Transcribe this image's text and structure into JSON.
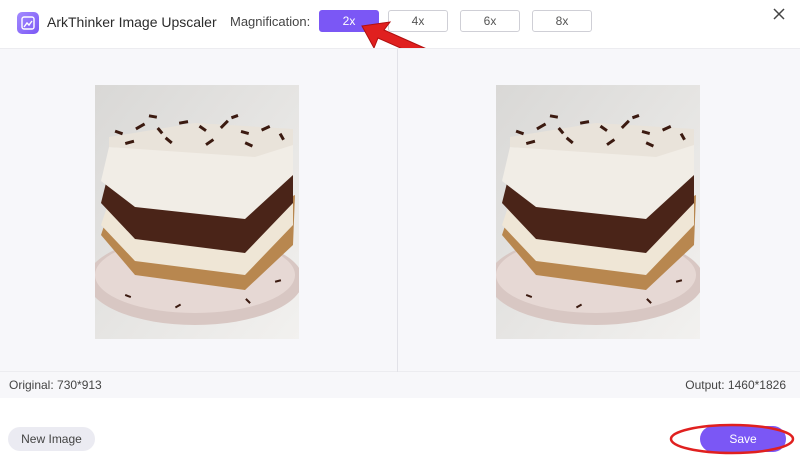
{
  "app": {
    "title": "ArkThinker Image Upscaler",
    "logo_icon": "image-upscale-icon"
  },
  "magnification": {
    "label": "Magnification:",
    "options": [
      "2x",
      "4x",
      "6x",
      "8x"
    ],
    "selected": "2x"
  },
  "preview": {
    "original_label": "Original: 730*913",
    "output_label": "Output: 1460*1826"
  },
  "footer": {
    "new_image_label": "New Image",
    "save_label": "Save"
  },
  "colors": {
    "accent": "#7b57f5",
    "annotation": "#e0201f"
  },
  "icons": {
    "close": "close-icon",
    "annotation_arrow": "red-arrow-annotation",
    "annotation_circle": "red-ellipse-annotation"
  }
}
